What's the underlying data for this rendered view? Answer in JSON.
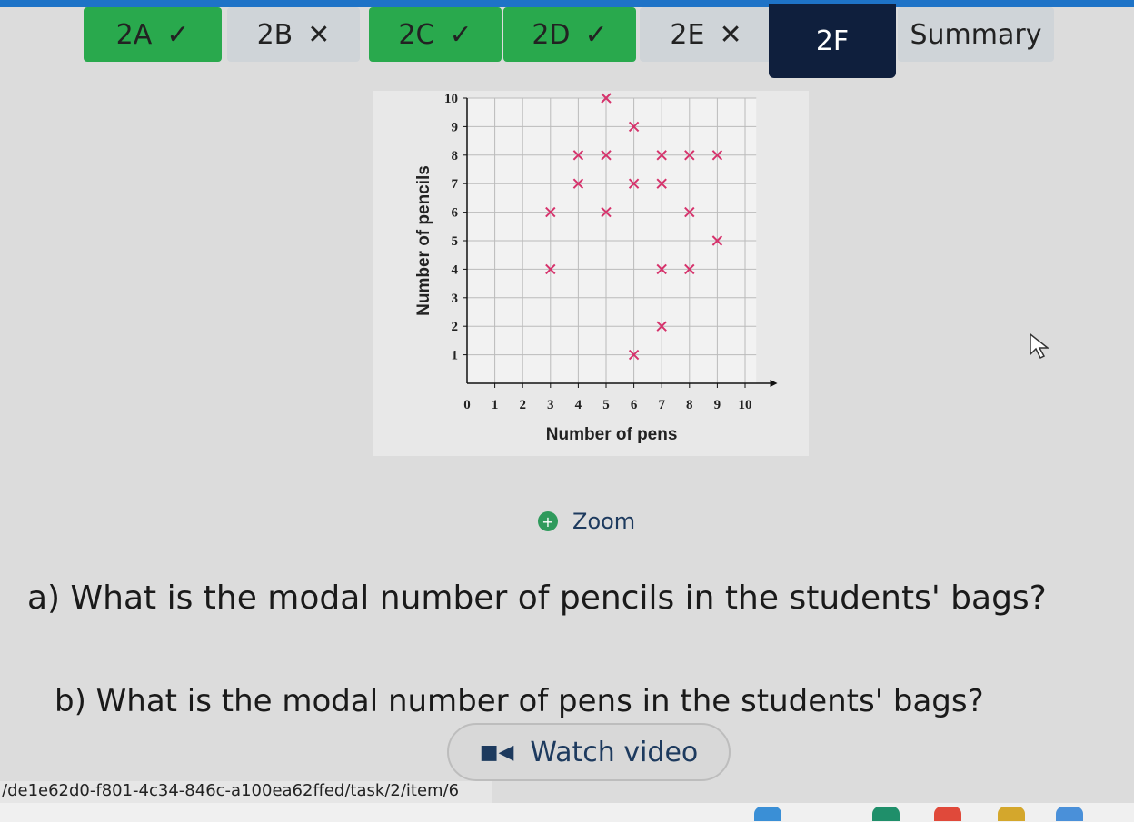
{
  "tabs": [
    {
      "label": "2A",
      "mark": "✓",
      "state": "correct",
      "left": 0,
      "width": 152
    },
    {
      "label": "2B",
      "mark": "✕",
      "state": "wrong",
      "left": 158,
      "width": 146
    },
    {
      "label": "2C",
      "mark": "✓",
      "state": "correct",
      "left": 314,
      "width": 146
    },
    {
      "label": "2D",
      "mark": "✓",
      "state": "correct",
      "left": 462,
      "width": 146
    },
    {
      "label": "2E",
      "mark": "✕",
      "state": "wrong",
      "left": 612,
      "width": 146
    },
    {
      "label": "2F",
      "mark": "",
      "state": "current",
      "left": 754,
      "width": 140
    },
    {
      "label": "Summary",
      "mark": "",
      "state": "summary",
      "left": 896,
      "width": 172
    }
  ],
  "chart_data": {
    "type": "scatter",
    "xlabel": "Number of pens",
    "ylabel": "Number of pencils",
    "xlim": [
      0,
      10
    ],
    "ylim": [
      0,
      10
    ],
    "xticks": [
      0,
      1,
      2,
      3,
      4,
      5,
      6,
      7,
      8,
      9,
      10
    ],
    "yticks": [
      1,
      2,
      3,
      4,
      5,
      6,
      7,
      8,
      9,
      10
    ],
    "ytick_labels": [
      "1",
      "2",
      "3",
      "4",
      "5",
      "6",
      "7",
      "8",
      "9",
      "10"
    ],
    "points": [
      {
        "x": 5,
        "y": 10
      },
      {
        "x": 6,
        "y": 9
      },
      {
        "x": 4,
        "y": 8
      },
      {
        "x": 5,
        "y": 8
      },
      {
        "x": 7,
        "y": 8
      },
      {
        "x": 8,
        "y": 8
      },
      {
        "x": 9,
        "y": 8
      },
      {
        "x": 4,
        "y": 7
      },
      {
        "x": 6,
        "y": 7
      },
      {
        "x": 7,
        "y": 7
      },
      {
        "x": 3,
        "y": 6
      },
      {
        "x": 5,
        "y": 6
      },
      {
        "x": 8,
        "y": 6
      },
      {
        "x": 9,
        "y": 5
      },
      {
        "x": 3,
        "y": 4
      },
      {
        "x": 7,
        "y": 4
      },
      {
        "x": 8,
        "y": 4
      },
      {
        "x": 7,
        "y": 2
      },
      {
        "x": 6,
        "y": 1
      }
    ],
    "marker_color": "#d6336c",
    "grid": true
  },
  "zoom_label": "Zoom",
  "questions": {
    "a": "a) What is the modal number of pencils in the students' bags?",
    "b": "b) What is the modal number of pens in the students' bags?"
  },
  "video_label": "Watch video",
  "url_text": "/de1e62d0-f801-4c34-846c-a100ea62ffed/task/2/item/6"
}
